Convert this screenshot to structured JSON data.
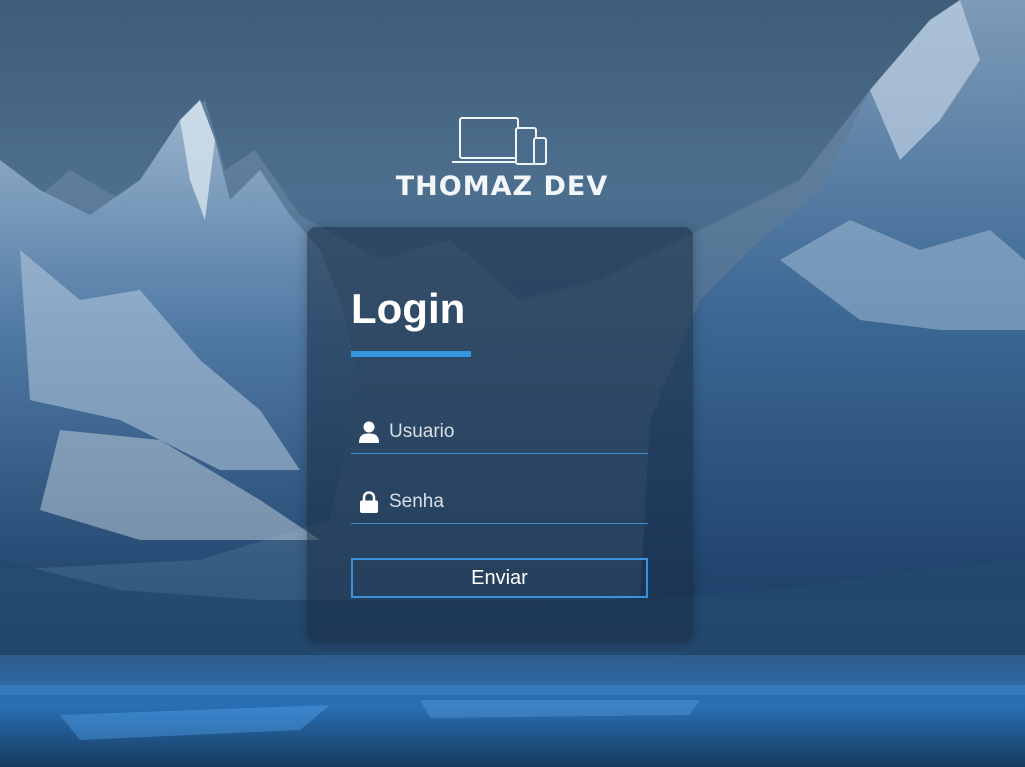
{
  "brand": {
    "logo_text": "THOMAZ DEV",
    "icon": "devices-icon"
  },
  "login": {
    "title": "Login",
    "username": {
      "icon": "user-icon",
      "placeholder": "Usuario",
      "value": ""
    },
    "password": {
      "icon": "lock-icon",
      "placeholder": "Senha",
      "value": ""
    },
    "submit_label": "Enviar"
  },
  "colors": {
    "accent": "#3596e0",
    "card_background": "rgba(23, 43, 66, 0.55)",
    "text": "#ffffff"
  }
}
